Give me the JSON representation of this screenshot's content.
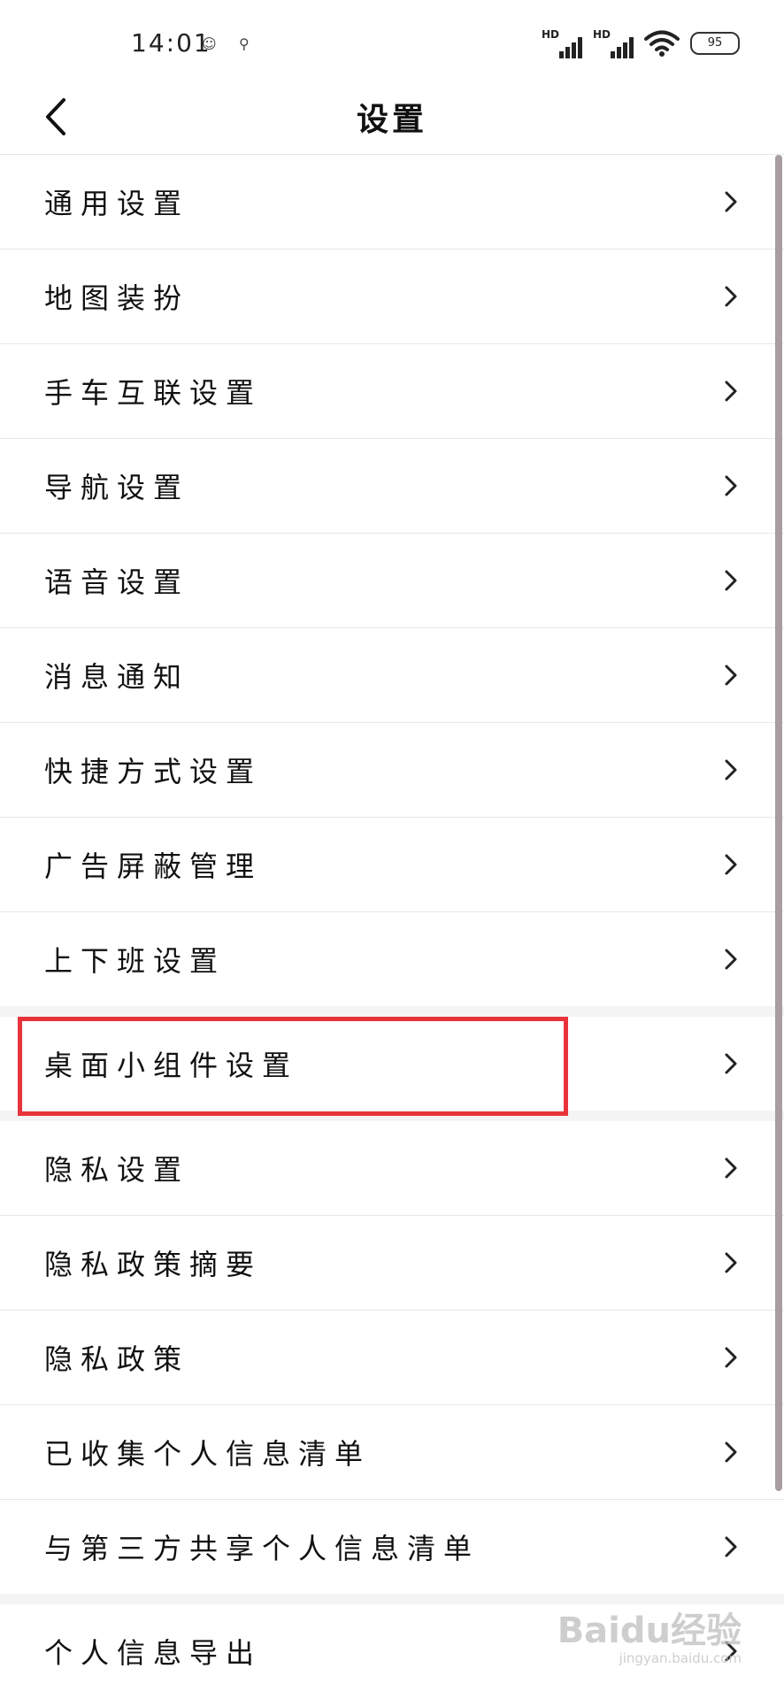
{
  "status_bar": {
    "time": "14:01",
    "battery": "95",
    "hd_label_1": "HD",
    "hd_label_2": "HD"
  },
  "header": {
    "title": "设置"
  },
  "groups": [
    {
      "items": [
        {
          "label": "通用设置"
        },
        {
          "label": "地图装扮"
        },
        {
          "label": "手车互联设置"
        },
        {
          "label": "导航设置"
        },
        {
          "label": "语音设置"
        },
        {
          "label": "消息通知"
        },
        {
          "label": "快捷方式设置"
        },
        {
          "label": "广告屏蔽管理"
        },
        {
          "label": "上下班设置"
        }
      ]
    },
    {
      "items": [
        {
          "label": "桌面小组件设置"
        }
      ]
    },
    {
      "items": [
        {
          "label": "隐私设置"
        },
        {
          "label": "隐私政策摘要"
        },
        {
          "label": "隐私政策"
        },
        {
          "label": "已收集个人信息清单"
        },
        {
          "label": "与第三方共享个人信息清单"
        }
      ]
    },
    {
      "items": [
        {
          "label": "个人信息导出"
        }
      ]
    }
  ],
  "highlight_color": "#e8333b",
  "watermark": {
    "text": "Baidu经验",
    "sub": "jingyan.baidu.com"
  }
}
